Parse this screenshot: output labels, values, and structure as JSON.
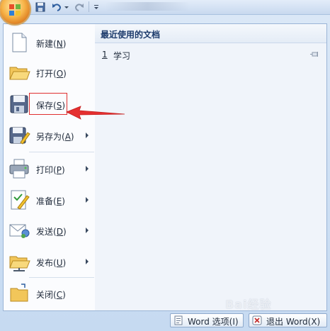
{
  "menu": {
    "items": [
      {
        "label": "新建",
        "mnemonic": "N",
        "has_arrow": false
      },
      {
        "label": "打开",
        "mnemonic": "O",
        "has_arrow": false
      },
      {
        "label": "保存",
        "mnemonic": "S",
        "has_arrow": false
      },
      {
        "label": "另存为",
        "mnemonic": "A",
        "has_arrow": true
      },
      {
        "label": "打印",
        "mnemonic": "P",
        "has_arrow": true
      },
      {
        "label": "准备",
        "mnemonic": "E",
        "has_arrow": true
      },
      {
        "label": "发送",
        "mnemonic": "D",
        "has_arrow": true
      },
      {
        "label": "发布",
        "mnemonic": "U",
        "has_arrow": true
      },
      {
        "label": "关闭",
        "mnemonic": "C",
        "has_arrow": false
      }
    ]
  },
  "recent": {
    "title": "最近使用的文档",
    "items": [
      {
        "number": "1",
        "name": "学习"
      }
    ]
  },
  "footer": {
    "word_options": "Word 选项(I)",
    "exit_word": "退出 Word(X)"
  },
  "watermark": "Bai经验",
  "colors": {
    "annotation": "#e03030",
    "accent": "#1b3a6b"
  }
}
